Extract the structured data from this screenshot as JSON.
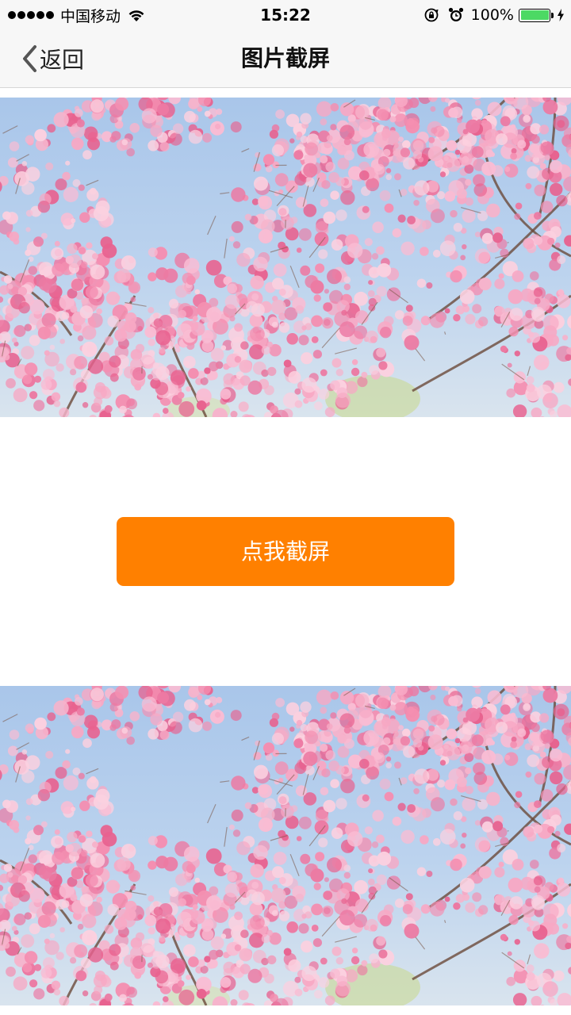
{
  "status_bar": {
    "carrier": "中国移动",
    "time": "15:22",
    "battery_percent": "100%",
    "battery_level": 1.0,
    "battery_color": "#4cd964",
    "signal_bars": 5,
    "icons": [
      "wifi-icon",
      "rotation-lock-icon",
      "alarm-icon",
      "battery-icon",
      "charging-bolt-icon"
    ]
  },
  "nav": {
    "back_label": "返回",
    "title": "图片截屏"
  },
  "images": [
    {
      "subject": "cherry-blossom-photo"
    },
    {
      "subject": "cherry-blossom-photo"
    }
  ],
  "screenshot_button": {
    "label": "点我截屏",
    "color": "#ff8000"
  }
}
